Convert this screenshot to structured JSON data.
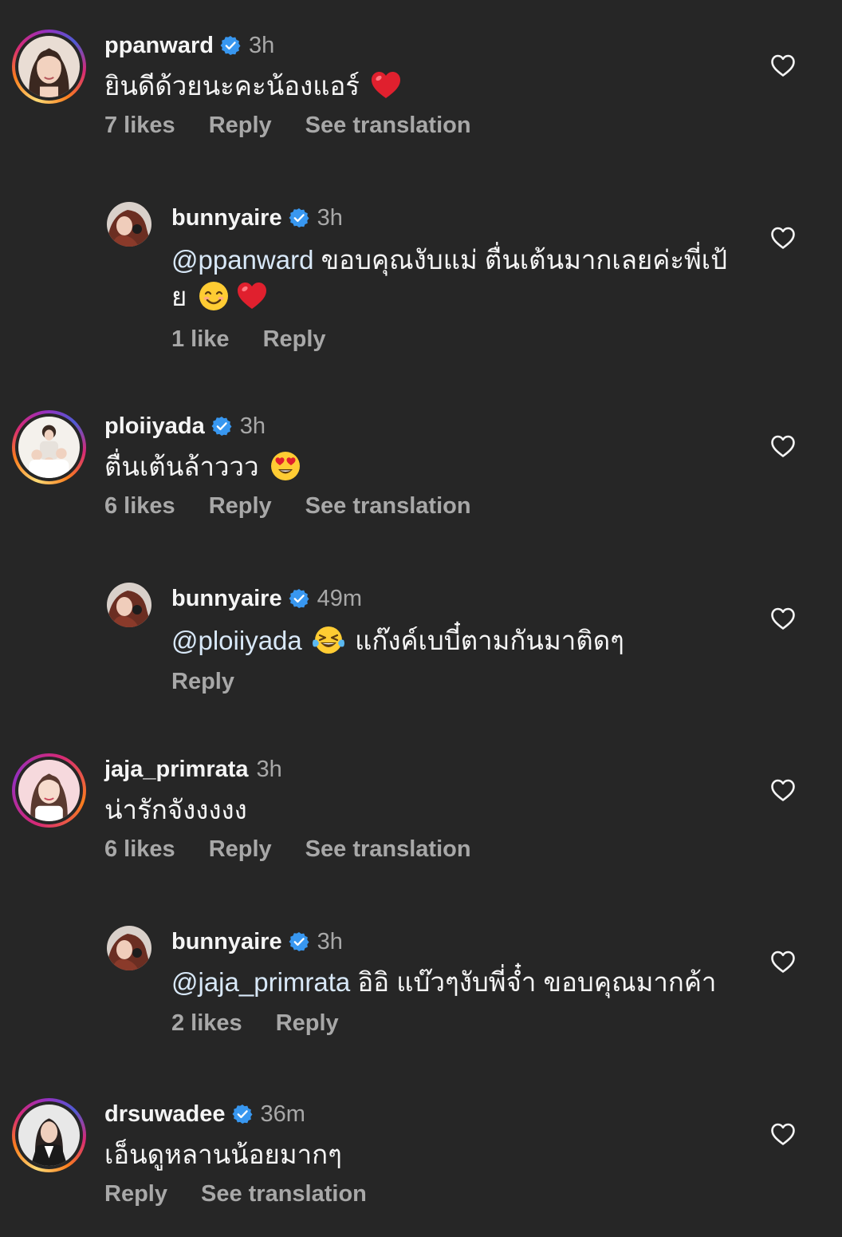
{
  "comments": [
    {
      "username": "ppanward",
      "verified": true,
      "time": "3h",
      "text": "ยินดีด้วยนะคะน้องแอร์",
      "emoji": [
        "red-heart"
      ],
      "likes": "7 likes",
      "reply_label": "Reply",
      "translation_label": "See translation",
      "avatar": "avatar-ppanward"
    },
    {
      "username": "bunnyaire",
      "verified": true,
      "time": "3h",
      "mention": "@ppanward",
      "text": "ขอบคุณงับแม่ ตื่นเต้นมากเลยค่ะพี่เป้",
      "text2": "ย",
      "emoji": [
        "smiling-face",
        "red-heart"
      ],
      "likes": "1 like",
      "reply_label": "Reply",
      "avatar": "avatar-bunnyaire"
    },
    {
      "username": "ploiiyada",
      "verified": true,
      "time": "3h",
      "text": "ตื่นเต้นล้าววว",
      "emoji": [
        "heart-eyes"
      ],
      "likes": "6 likes",
      "reply_label": "Reply",
      "translation_label": "See translation",
      "avatar": "avatar-ploiiyada"
    },
    {
      "username": "bunnyaire",
      "verified": true,
      "time": "49m",
      "mention": "@ploiiyada",
      "text": "แก๊งค์เบบี๋ตามกันมาติดๆ",
      "emoji": [
        "tears-of-joy"
      ],
      "reply_label": "Reply",
      "avatar": "avatar-bunnyaire"
    },
    {
      "username": "jaja_primrata",
      "verified": false,
      "time": "3h",
      "text": "น่ารักจังงงงง",
      "likes": "6 likes",
      "reply_label": "Reply",
      "translation_label": "See translation",
      "avatar": "avatar-jaja"
    },
    {
      "username": "bunnyaire",
      "verified": true,
      "time": "3h",
      "mention": "@jaja_primrata",
      "text": "อิอิ แบ๊วๆงับพี่จ๋ำ ขอบคุณมากค้า",
      "likes": "2 likes",
      "reply_label": "Reply",
      "avatar": "avatar-bunnyaire"
    },
    {
      "username": "drsuwadee",
      "verified": true,
      "time": "36m",
      "text": "เอ็นดูหลานน้อยมากๆ",
      "reply_label": "Reply",
      "translation_label": "See translation",
      "avatar": "avatar-drsuwadee"
    }
  ],
  "colors": {
    "background": "#262626",
    "primary_text": "#f5f5f5",
    "secondary_text": "#a8a8a8",
    "verified_blue": "#3897f0",
    "heart_outline": "#f5f5f5"
  },
  "icons": {
    "verified": "verified-badge-icon",
    "like": "heart-outline-icon"
  }
}
